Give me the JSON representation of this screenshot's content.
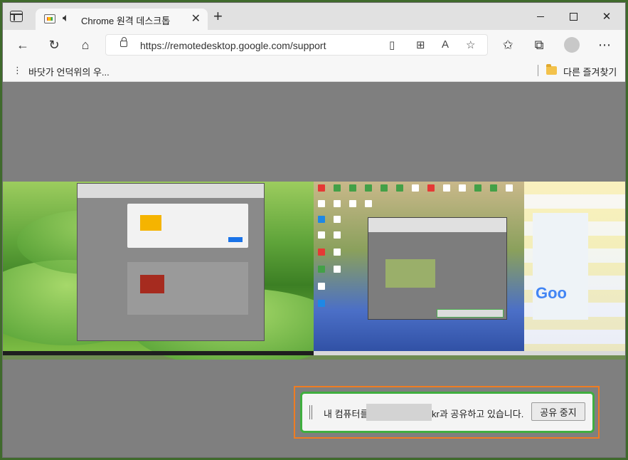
{
  "tab": {
    "title": "Chrome 원격 데스크톱"
  },
  "toolbar": {
    "url": "https://remotedesktop.google.com/support"
  },
  "favorites": {
    "items": [
      {
        "label": "바닷가 언덕위의 우..."
      }
    ],
    "other_label": "다른 즐겨찾기"
  },
  "share_bar": {
    "prefix": "내 컴퓨터를",
    "suffix": "kr과 공유하고 있습니다.",
    "stop_button_label": "공유 중지"
  },
  "colors": {
    "share_border": "#3fae3f",
    "highlight_box": "#ef7c22"
  },
  "icons": [
    "tab-actions-icon",
    "favicon-icon",
    "speaker-icon",
    "close-icon",
    "plus-icon",
    "back-icon",
    "refresh-icon",
    "home-icon",
    "lock-icon",
    "reading-list-icon",
    "apps-icon",
    "read-aloud-icon",
    "add-favorite-icon",
    "favorites-icon",
    "collections-icon",
    "profile-icon",
    "more-icon",
    "folder-icon"
  ]
}
